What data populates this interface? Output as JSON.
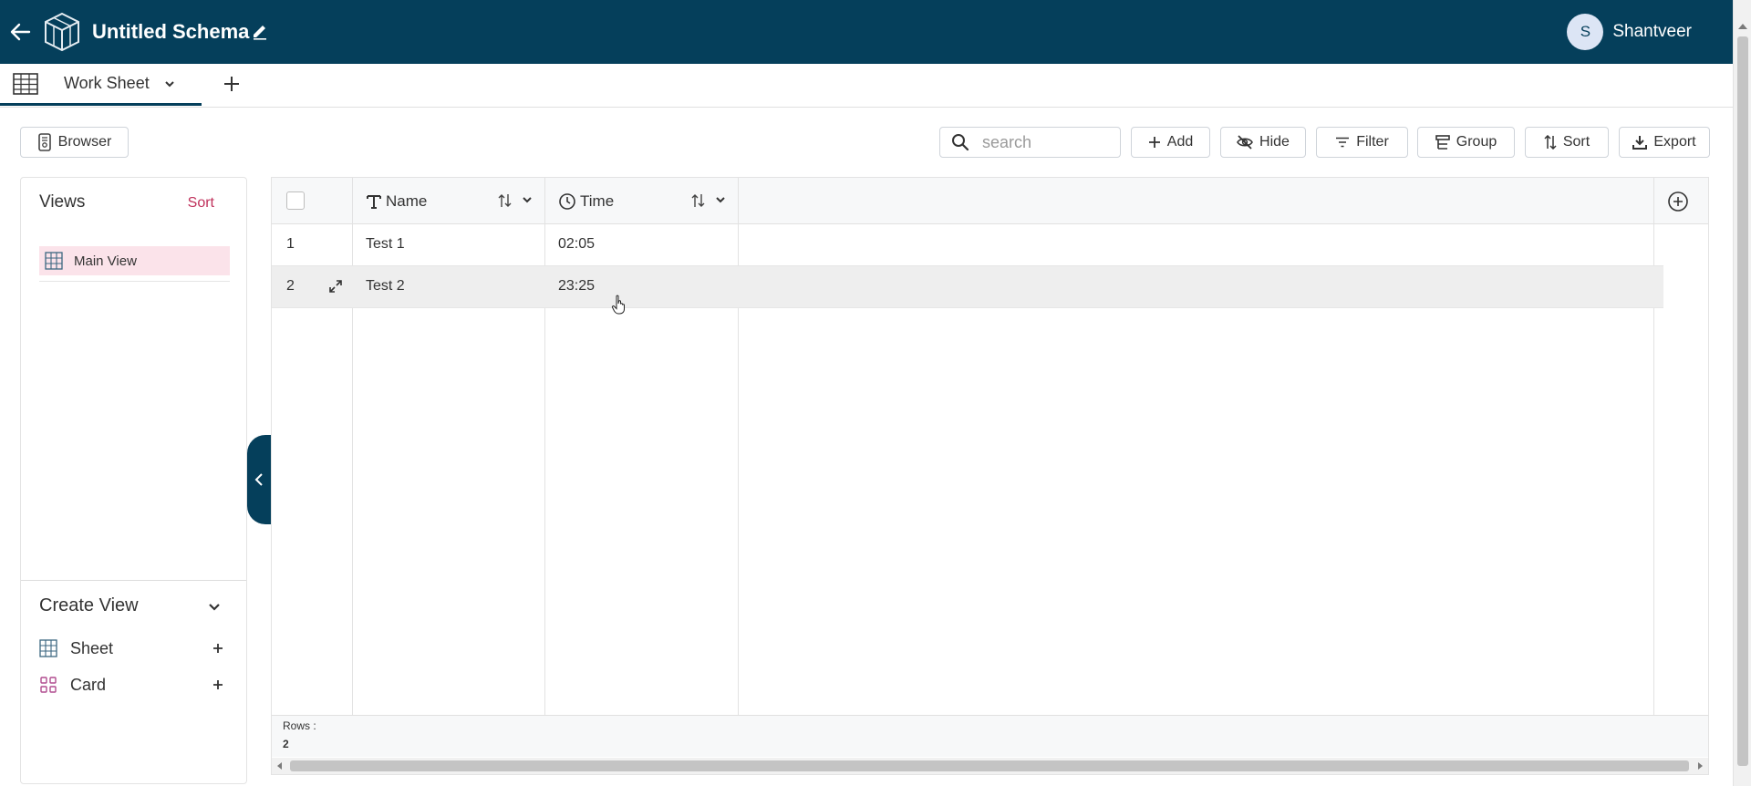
{
  "app": {
    "title": "Untitled Schema",
    "user": {
      "initial": "S",
      "name": "Shantveer"
    }
  },
  "tabs": [
    {
      "label": "Work Sheet",
      "active": true
    }
  ],
  "toolbar": {
    "browser_label": "Browser",
    "search_placeholder": "search",
    "add_label": "Add",
    "hide_label": "Hide",
    "filter_label": "Filter",
    "group_label": "Group",
    "sort_label": "Sort",
    "export_label": "Export"
  },
  "views": {
    "title": "Views",
    "sort_label": "Sort",
    "items": [
      {
        "label": "Main View",
        "selected": true
      }
    ]
  },
  "create_view": {
    "title": "Create View",
    "items": [
      {
        "label": "Sheet",
        "icon": "grid-icon"
      },
      {
        "label": "Card",
        "icon": "card-grid-icon"
      }
    ]
  },
  "table": {
    "columns": [
      {
        "name": "Name",
        "type_icon": "text-type-icon"
      },
      {
        "name": "Time",
        "type_icon": "clock-icon"
      }
    ],
    "rows": [
      {
        "index": "1",
        "cells": [
          "Test 1",
          "02:05"
        ]
      },
      {
        "index": "2",
        "cells": [
          "Test 2",
          "23:25"
        ]
      }
    ],
    "footer": {
      "rows_label": "Rows :",
      "rows_count": "2"
    }
  },
  "colors": {
    "header_bg": "#053f5b",
    "accent_pink": "#c0325c",
    "selected_view_bg": "#fbe3ea"
  }
}
